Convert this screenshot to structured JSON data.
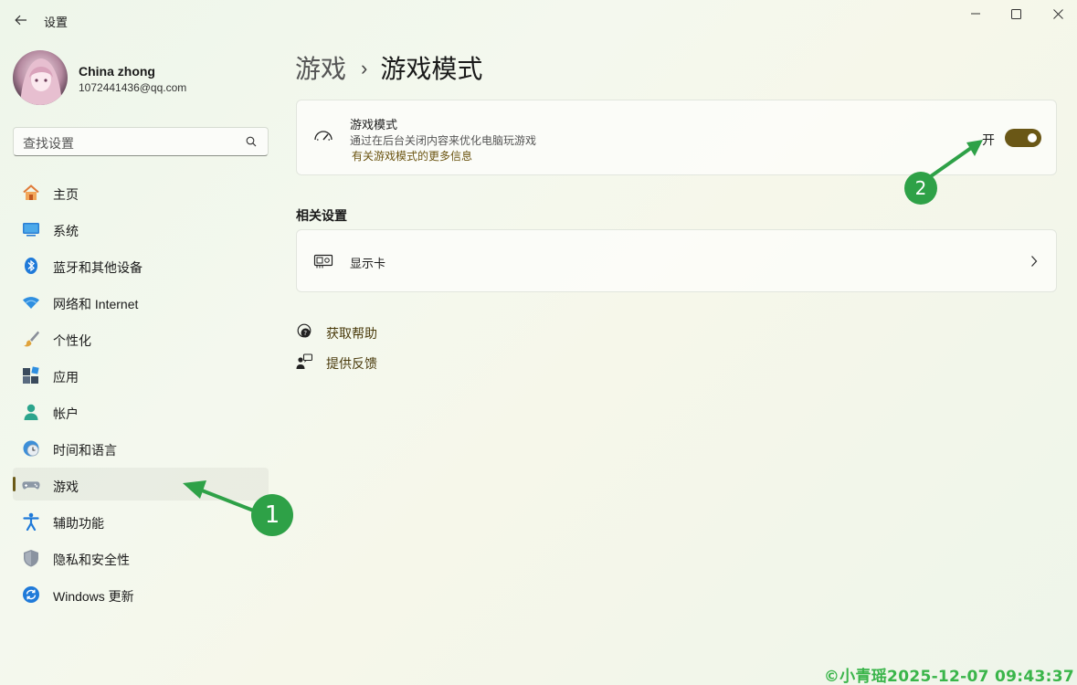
{
  "window": {
    "title": "设置",
    "controls": [
      "minimize",
      "maximize",
      "close"
    ]
  },
  "profile": {
    "name": "China zhong",
    "email": "1072441436@qq.com"
  },
  "search": {
    "placeholder": "查找设置"
  },
  "sidebar": {
    "items": [
      {
        "label": "主页",
        "icon": "home-icon"
      },
      {
        "label": "系统",
        "icon": "monitor-icon"
      },
      {
        "label": "蓝牙和其他设备",
        "icon": "bluetooth-icon"
      },
      {
        "label": "网络和 Internet",
        "icon": "wifi-icon"
      },
      {
        "label": "个性化",
        "icon": "brush-icon"
      },
      {
        "label": "应用",
        "icon": "apps-icon"
      },
      {
        "label": "帐户",
        "icon": "person-icon"
      },
      {
        "label": "时间和语言",
        "icon": "clock-globe-icon"
      },
      {
        "label": "游戏",
        "icon": "gamepad-icon",
        "selected": true
      },
      {
        "label": "辅助功能",
        "icon": "accessibility-icon"
      },
      {
        "label": "隐私和安全性",
        "icon": "shield-icon"
      },
      {
        "label": "Windows 更新",
        "icon": "update-icon"
      }
    ]
  },
  "breadcrumb": {
    "parent": "游戏",
    "separator": "›",
    "current": "游戏模式"
  },
  "game_mode_card": {
    "title": "游戏模式",
    "description": "通过在后台关闭内容来优化电脑玩游戏",
    "link": "有关游戏模式的更多信息",
    "toggle_label": "开",
    "toggle_on": true
  },
  "related": {
    "heading": "相关设置",
    "items": [
      {
        "label": "显示卡"
      }
    ]
  },
  "help": {
    "get_help": "获取帮助",
    "feedback": "提供反馈"
  },
  "annotations": {
    "badge1": "1",
    "badge2": "2"
  },
  "watermark": "©小青瑶2025-12-07 09:43:37",
  "colors": {
    "accent": "#6a5716",
    "link": "#6b5411",
    "annotation": "#2ea147",
    "watermark": "#3ab54a"
  }
}
